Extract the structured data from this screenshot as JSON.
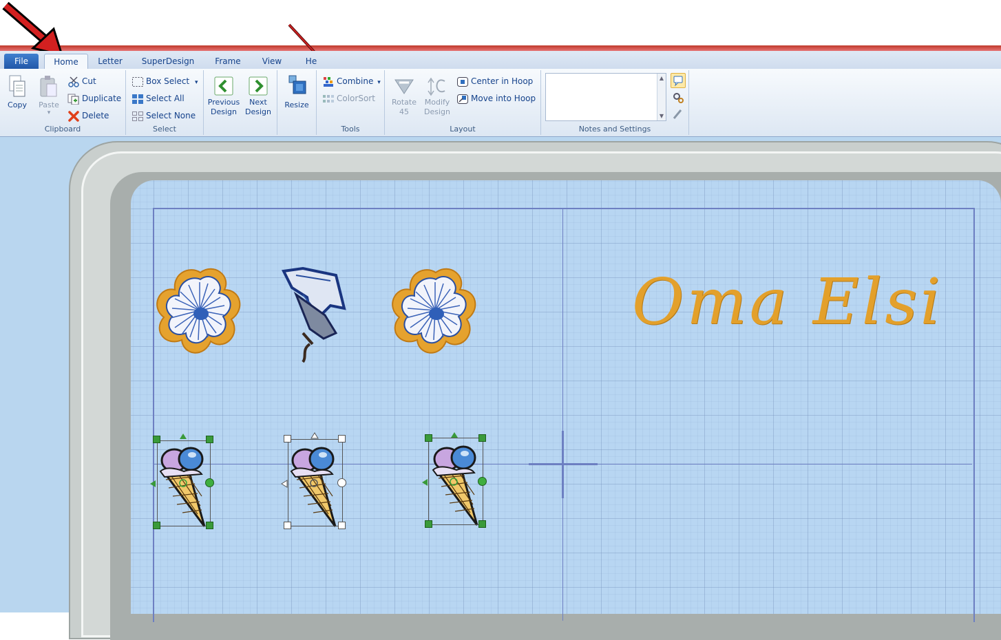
{
  "tabs": [
    {
      "id": "file",
      "label": "File"
    },
    {
      "id": "home",
      "label": "Home"
    },
    {
      "id": "letter",
      "label": "Letter"
    },
    {
      "id": "superdesign",
      "label": "SuperDesign"
    },
    {
      "id": "frame",
      "label": "Frame"
    },
    {
      "id": "view",
      "label": "View"
    },
    {
      "id": "help",
      "label": "He"
    }
  ],
  "clipboard": {
    "copy": "Copy",
    "paste": "Paste",
    "cut": "Cut",
    "duplicate": "Duplicate",
    "delete": "Delete",
    "label": "Clipboard"
  },
  "select": {
    "box_select": "Box Select",
    "select_all": "Select All",
    "select_none": "Select None",
    "label": "Select"
  },
  "navigate": {
    "previous_line1": "Previous",
    "previous_line2": "Design",
    "next_line1": "Next",
    "next_line2": "Design"
  },
  "resize": {
    "label": "Resize"
  },
  "tools": {
    "combine": "Combine",
    "colorsort": "ColorSort",
    "label": "Tools"
  },
  "layout": {
    "rotate_line1": "Rotate",
    "rotate_line2": "45",
    "modify_line1": "Modify",
    "modify_line2": "Design",
    "center_in_hoop": "Center in Hoop",
    "move_into_hoop": "Move into Hoop",
    "label": "Layout"
  },
  "notes": {
    "label": "Notes and Settings"
  },
  "canvas": {
    "embroidery_text": "Oma  Elsi"
  },
  "colors": {
    "accent_blue": "#15428b",
    "file_tab": "#2257a8",
    "hoop_fabric": "#b8d6f2",
    "thread_gold": "#e3a02b",
    "arrow_red": "#d32020"
  }
}
